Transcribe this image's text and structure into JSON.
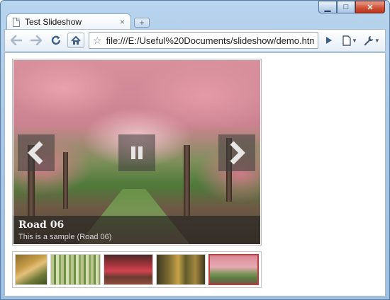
{
  "browser": {
    "tab_title": "Test Slideshow",
    "tab_close": "×",
    "new_tab": "+",
    "url": "file:///E:/Useful%20Documents/slideshow/demo.htm",
    "window_controls": {
      "minimize": "▁",
      "maximize": "□",
      "close": "✕"
    }
  },
  "slideshow": {
    "caption_title": "Road 06",
    "caption_description": "This is a sample (Road 06)",
    "controls": [
      "prev-arrow-icon",
      "pause-icon",
      "next-arrow-icon"
    ],
    "thumbnails": [
      "road-01",
      "road-02",
      "road-03",
      "road-04",
      "road-06"
    ],
    "selected_thumbnail": 5,
    "selected_color": "#c43b3b"
  }
}
